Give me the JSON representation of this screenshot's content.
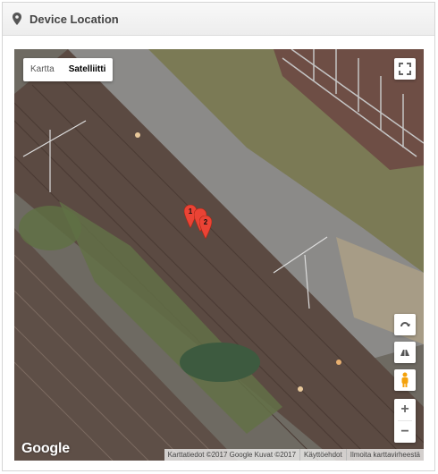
{
  "header": {
    "title": "Device Location",
    "icon": "map-pin-icon"
  },
  "map": {
    "type_options": [
      "Kartta",
      "Satelliitti"
    ],
    "selected_type": "Satelliitti",
    "markers": [
      "1",
      "2"
    ],
    "attribution": [
      "Karttatiedot ©2017 Google Kuvat ©2017",
      "Käyttöehdot",
      "Ilmoita karttavirheestä"
    ],
    "logo": "Google",
    "zoom_in": "+",
    "zoom_out": "−"
  },
  "colors": {
    "marker": "#ea4335",
    "accent_header": "#444444"
  }
}
